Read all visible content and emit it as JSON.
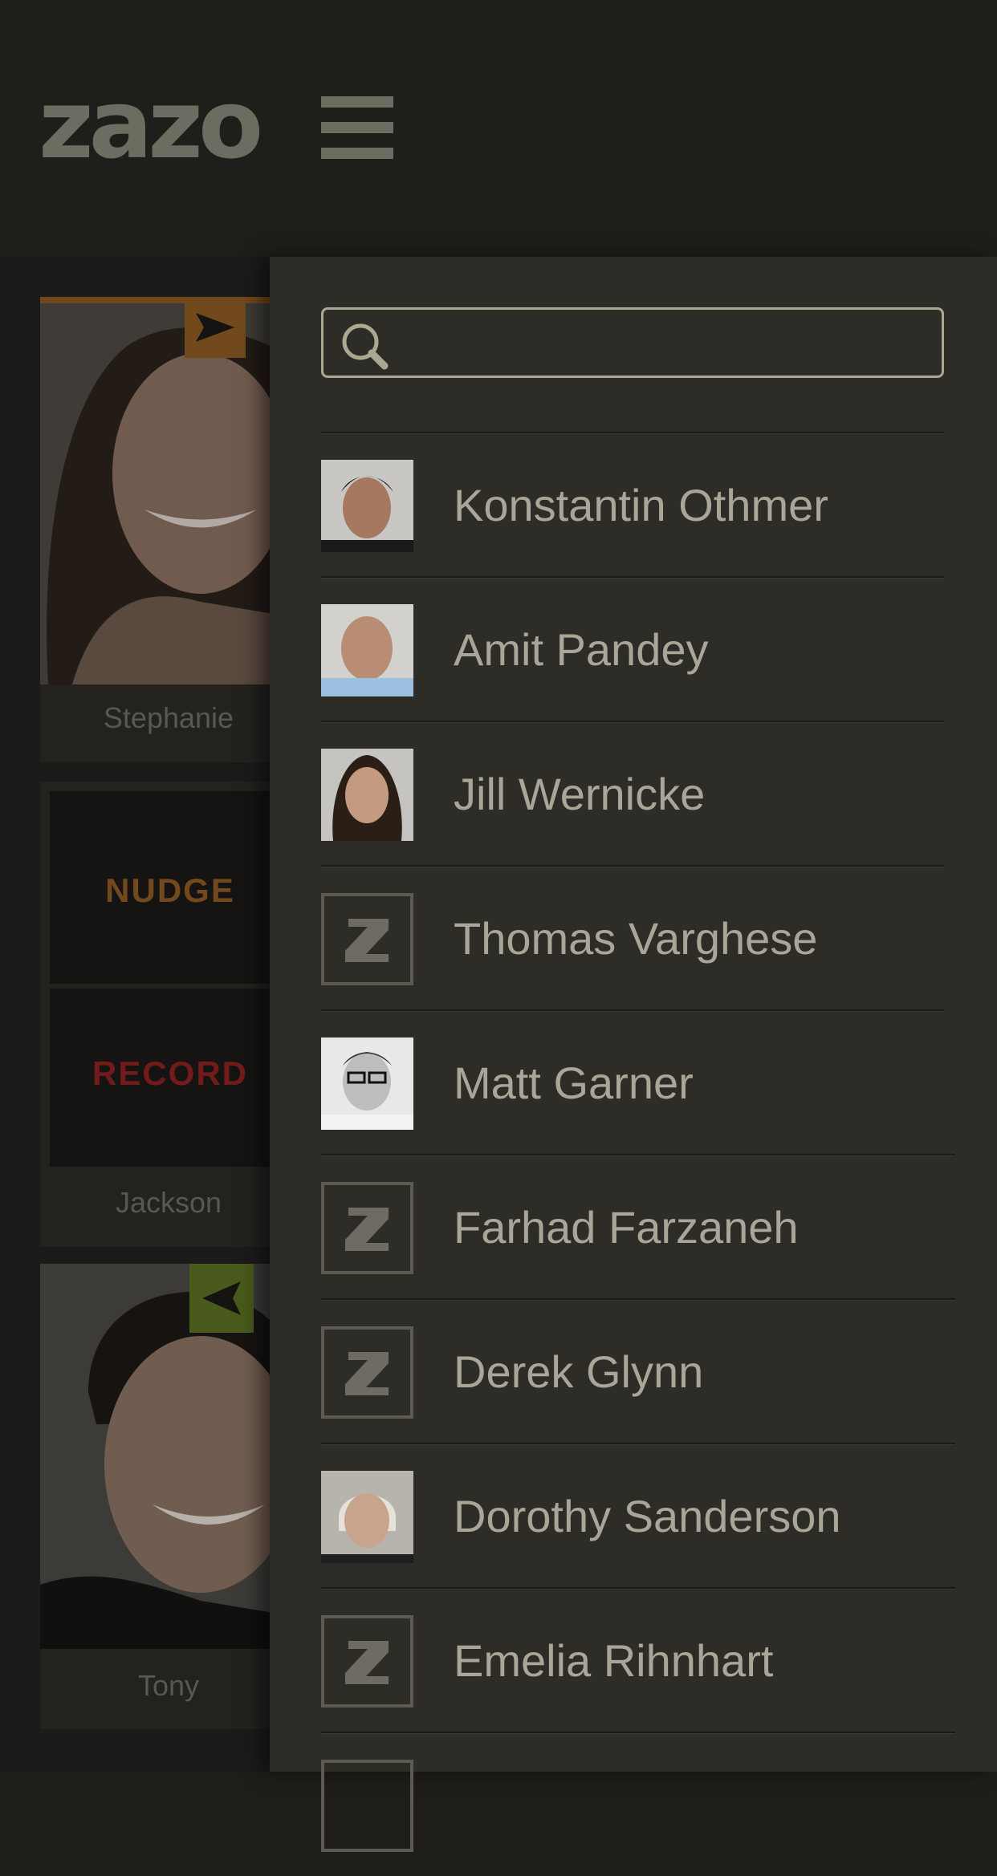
{
  "app": {
    "logo": "zazo"
  },
  "tiles": [
    {
      "name": "Stephanie",
      "indicator": "sent",
      "indicator_color": "#8a5a24"
    },
    {
      "name": "Jackson",
      "nudge_label": "NUDGE",
      "record_label": "RECORD",
      "nudge_color": "#8a5a24",
      "record_color": "#8c2222"
    },
    {
      "name": "Tony",
      "indicator": "received",
      "indicator_color": "#5a6e23"
    }
  ],
  "drawer": {
    "search": {
      "placeholder": "",
      "value": ""
    },
    "contacts": [
      {
        "name": "Konstantin Othmer",
        "avatar": "photo"
      },
      {
        "name": "Amit Pandey",
        "avatar": "photo"
      },
      {
        "name": "Jill Wernicke",
        "avatar": "photo"
      },
      {
        "name": "Thomas Varghese",
        "avatar": "z-placeholder"
      },
      {
        "name": "Matt Garner",
        "avatar": "photo"
      },
      {
        "name": "Farhad Farzaneh",
        "avatar": "z-placeholder"
      },
      {
        "name": "Derek Glynn",
        "avatar": "z-placeholder"
      },
      {
        "name": "Dorothy Sanderson",
        "avatar": "photo"
      },
      {
        "name": "Emelia Rihnhart",
        "avatar": "z-placeholder"
      }
    ]
  },
  "colors": {
    "background": "#1f1e1b",
    "drawer": "#2d2c27",
    "text": "#a9a698",
    "logo": "#6d6c61"
  }
}
